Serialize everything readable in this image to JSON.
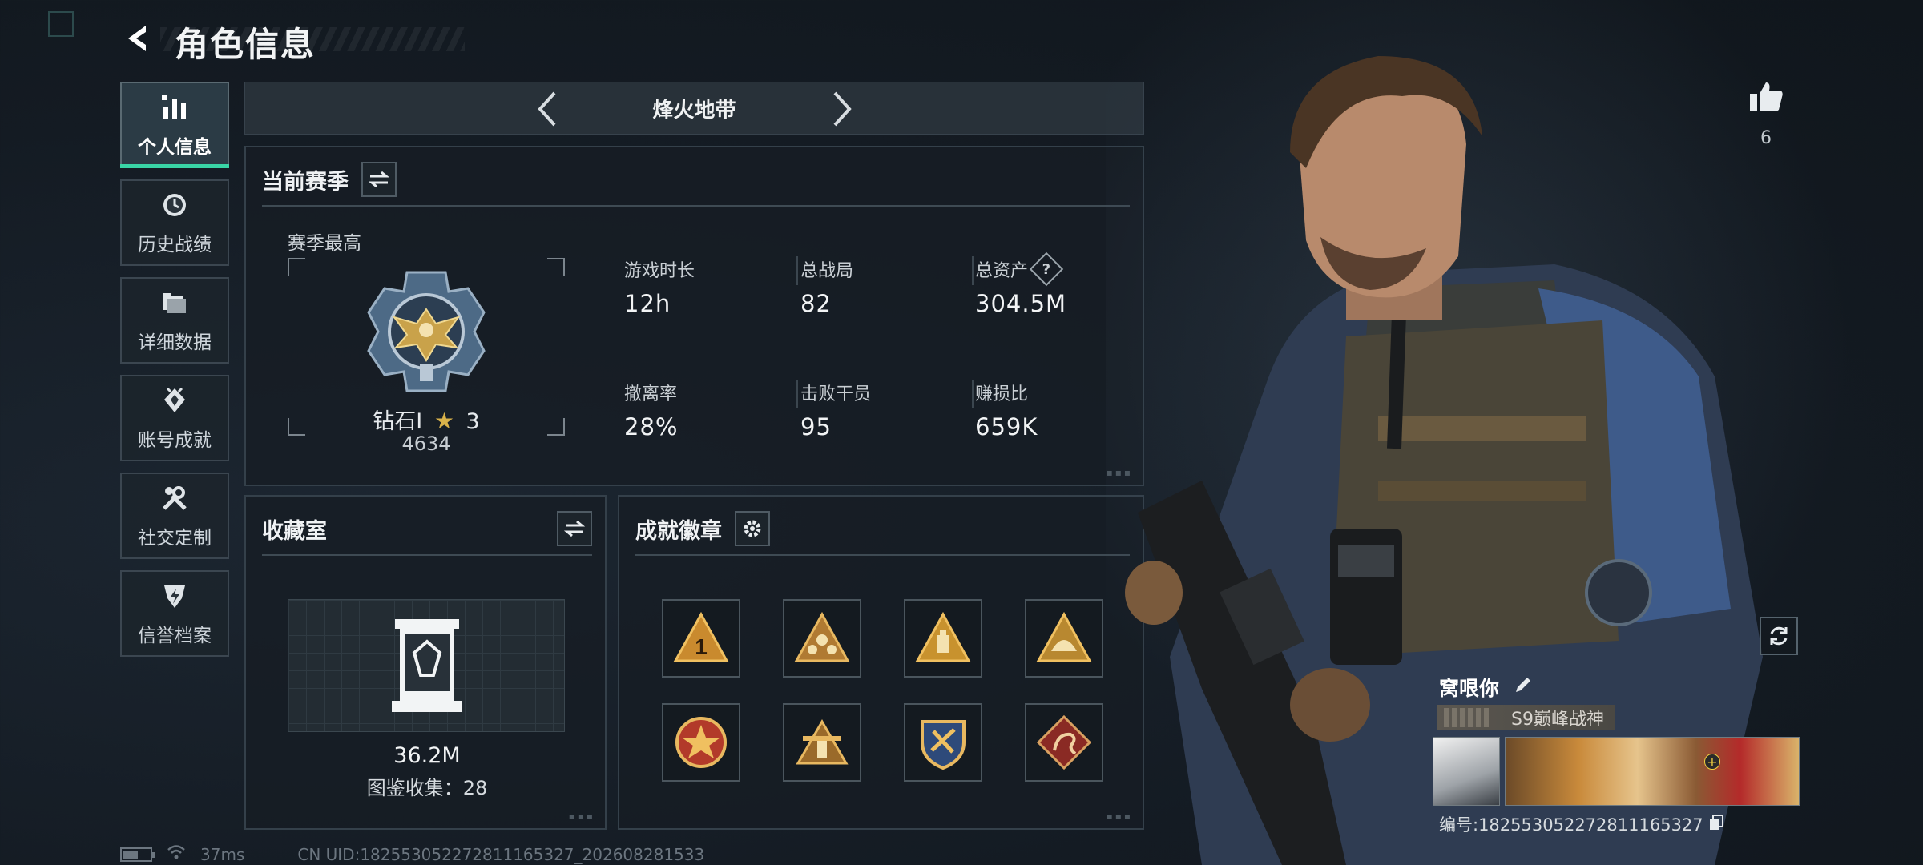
{
  "header": {
    "title": "角色信息"
  },
  "sidebar": {
    "items": [
      {
        "label": "个人信息",
        "icon": "bar-chart-icon",
        "active": true
      },
      {
        "label": "历史战绩",
        "icon": "history-clock-icon",
        "active": false
      },
      {
        "label": "详细数据",
        "icon": "folder-icon",
        "active": false
      },
      {
        "label": "账号成就",
        "icon": "achievement-icon",
        "active": false
      },
      {
        "label": "社交定制",
        "icon": "wrench-icon",
        "active": false
      },
      {
        "label": "信誉档案",
        "icon": "shield-icon",
        "active": false
      }
    ]
  },
  "mode_tab": {
    "title": "烽火地带"
  },
  "season": {
    "title": "当前赛季",
    "best_label": "赛季最高",
    "rank_name": "钻石Ⅰ",
    "rank_stars": "3",
    "rank_score": "4634",
    "stats": [
      {
        "label": "游戏时长",
        "value": "12h"
      },
      {
        "label": "总战局",
        "value": "82"
      },
      {
        "label": "总资产",
        "value": "304.5M",
        "help": "?"
      },
      {
        "label": "撤离率",
        "value": "28%"
      },
      {
        "label": "击败干员",
        "value": "95"
      },
      {
        "label": "赚损比",
        "value": "659K"
      }
    ]
  },
  "collection": {
    "title": "收藏室",
    "value": "36.2M",
    "count_text": "图鉴收集：28"
  },
  "badges": {
    "title": "成就徽章",
    "items": [
      "badge-1",
      "badge-2",
      "badge-3",
      "badge-4",
      "badge-5",
      "badge-6",
      "badge-7",
      "badge-8"
    ]
  },
  "likes": {
    "count": "6"
  },
  "player": {
    "name": "窝哏你",
    "title_tag": "S9巅峰战神",
    "id_text": "编号:1825530522728111653​27"
  },
  "footer": {
    "ping": "37ms",
    "uid": "CN UID:1825530522728111653​27_202608281533"
  },
  "colors": {
    "accent": "#39d5a6",
    "panel_border": "#34404a",
    "gold": "#c9a24a"
  }
}
